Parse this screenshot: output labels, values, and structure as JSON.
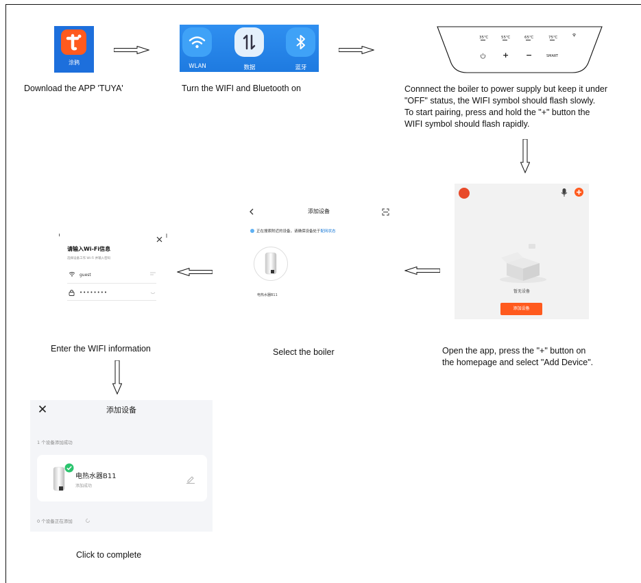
{
  "steps": {
    "download": {
      "caption": "Download the APP 'TUYA'",
      "app_icon_label": "涂鸦"
    },
    "wifi_bluetooth": {
      "caption": "Turn the WIFI and Bluetooth on",
      "tiles": [
        "WLAN",
        "数据",
        "蓝牙"
      ]
    },
    "connect": {
      "caption_lines": [
        "Connnect the boiler to power supply but keep it under",
        "\"OFF\" status, the WIFI symbol should flash slowly.",
        "To start pairing, press and hold the \"+\" button the",
        "WIFI symbol should flash rapidly."
      ],
      "panel": {
        "temps": [
          "35℃",
          "55℃",
          "65℃",
          "75℃"
        ],
        "plus": "+",
        "minus": "−",
        "smart": "SMART"
      }
    },
    "open_app": {
      "caption_lines": [
        "Open the app, press the \"+\" button on",
        "the homepage and select \"Add Device\"."
      ],
      "empty_text": "暂无设备",
      "add_button": "添加设备"
    },
    "select": {
      "caption": "Select the boiler",
      "title": "添加设备",
      "search_text": "正在搜索附近的设备，请确保设备处于",
      "search_link": "配网状态",
      "device_name": "电热水器B11"
    },
    "wifi_info": {
      "caption": "Enter the WIFI information",
      "title": "请输入Wi-Fi信息",
      "subtitle": "选择设备工作 Wi-Fi 并输入密码",
      "ssid": "guest",
      "password_mask": "••••••••"
    },
    "complete": {
      "caption": "Click to complete",
      "title": "添加设备",
      "added_count": "1 个设备添加成功",
      "device_name": "电热水器B11",
      "device_status": "添加成功",
      "adding_count": "0 个设备正在添加"
    }
  },
  "colors": {
    "tuya_orange": "#ff5a1e",
    "tuya_bg": "#1d6fdc",
    "qs_blue": "#2384e8",
    "success_green": "#2bc46e",
    "link_blue": "#1a7ad6"
  }
}
